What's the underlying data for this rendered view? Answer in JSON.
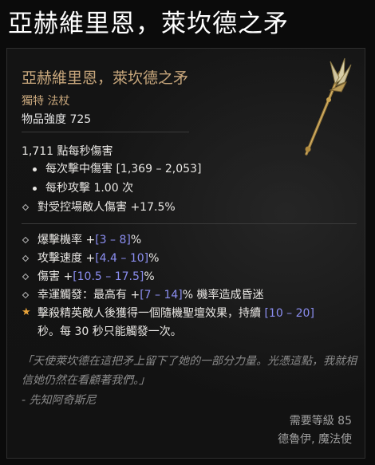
{
  "window_title": "亞赫維里恩，萊坎德之矛",
  "item": {
    "name": "亞赫維里恩，萊坎德之矛",
    "type": "獨特 法杖",
    "item_power": "物品強度 725",
    "dps": "1,711 點每秒傷害",
    "damage_per_hit": {
      "label": "每次擊中傷害 ",
      "range": "[1,369 – 2,053]"
    },
    "attacks_per_second": "每秒攻擊 1.00 次",
    "implicit": "對受控場敵人傷害 +17.5%",
    "affixes": [
      {
        "label": "爆擊機率 +",
        "range": "[3 – 8]",
        "suffix": "%"
      },
      {
        "label": "攻擊速度 +",
        "range": "[4.4 – 10]",
        "suffix": "%"
      },
      {
        "label": "傷害 +",
        "range": "[10.5 – 17.5]",
        "suffix": "%"
      },
      {
        "label": "幸運觸發：最高有 +",
        "range": "[7 – 14]",
        "suffix": "% 機率造成昏迷"
      }
    ],
    "unique_power": {
      "line1_a": "擊殺精英敵人後獲得一個隨機聖壇效果，持續 ",
      "line1_range": "[10 – 20]",
      "line2": "秒。每 30 秒只能觸發一次。"
    },
    "flavor_text": "「天使萊坎德在這把矛上留下了她的一部分力量。光憑這點，我就相信她仍然在看顧著我們。」",
    "attribution": "- 先知阿奇斯尼",
    "required_level": "需要等級 85",
    "class_requirement": "德魯伊, 魔法使"
  },
  "colors": {
    "unique_gold": "#c8a77c",
    "range_blue": "#8b8ef0",
    "star_orange": "#e8a33a"
  },
  "icons": [
    "diamond-bullet-icon",
    "star-icon",
    "spear-weapon-icon"
  ]
}
